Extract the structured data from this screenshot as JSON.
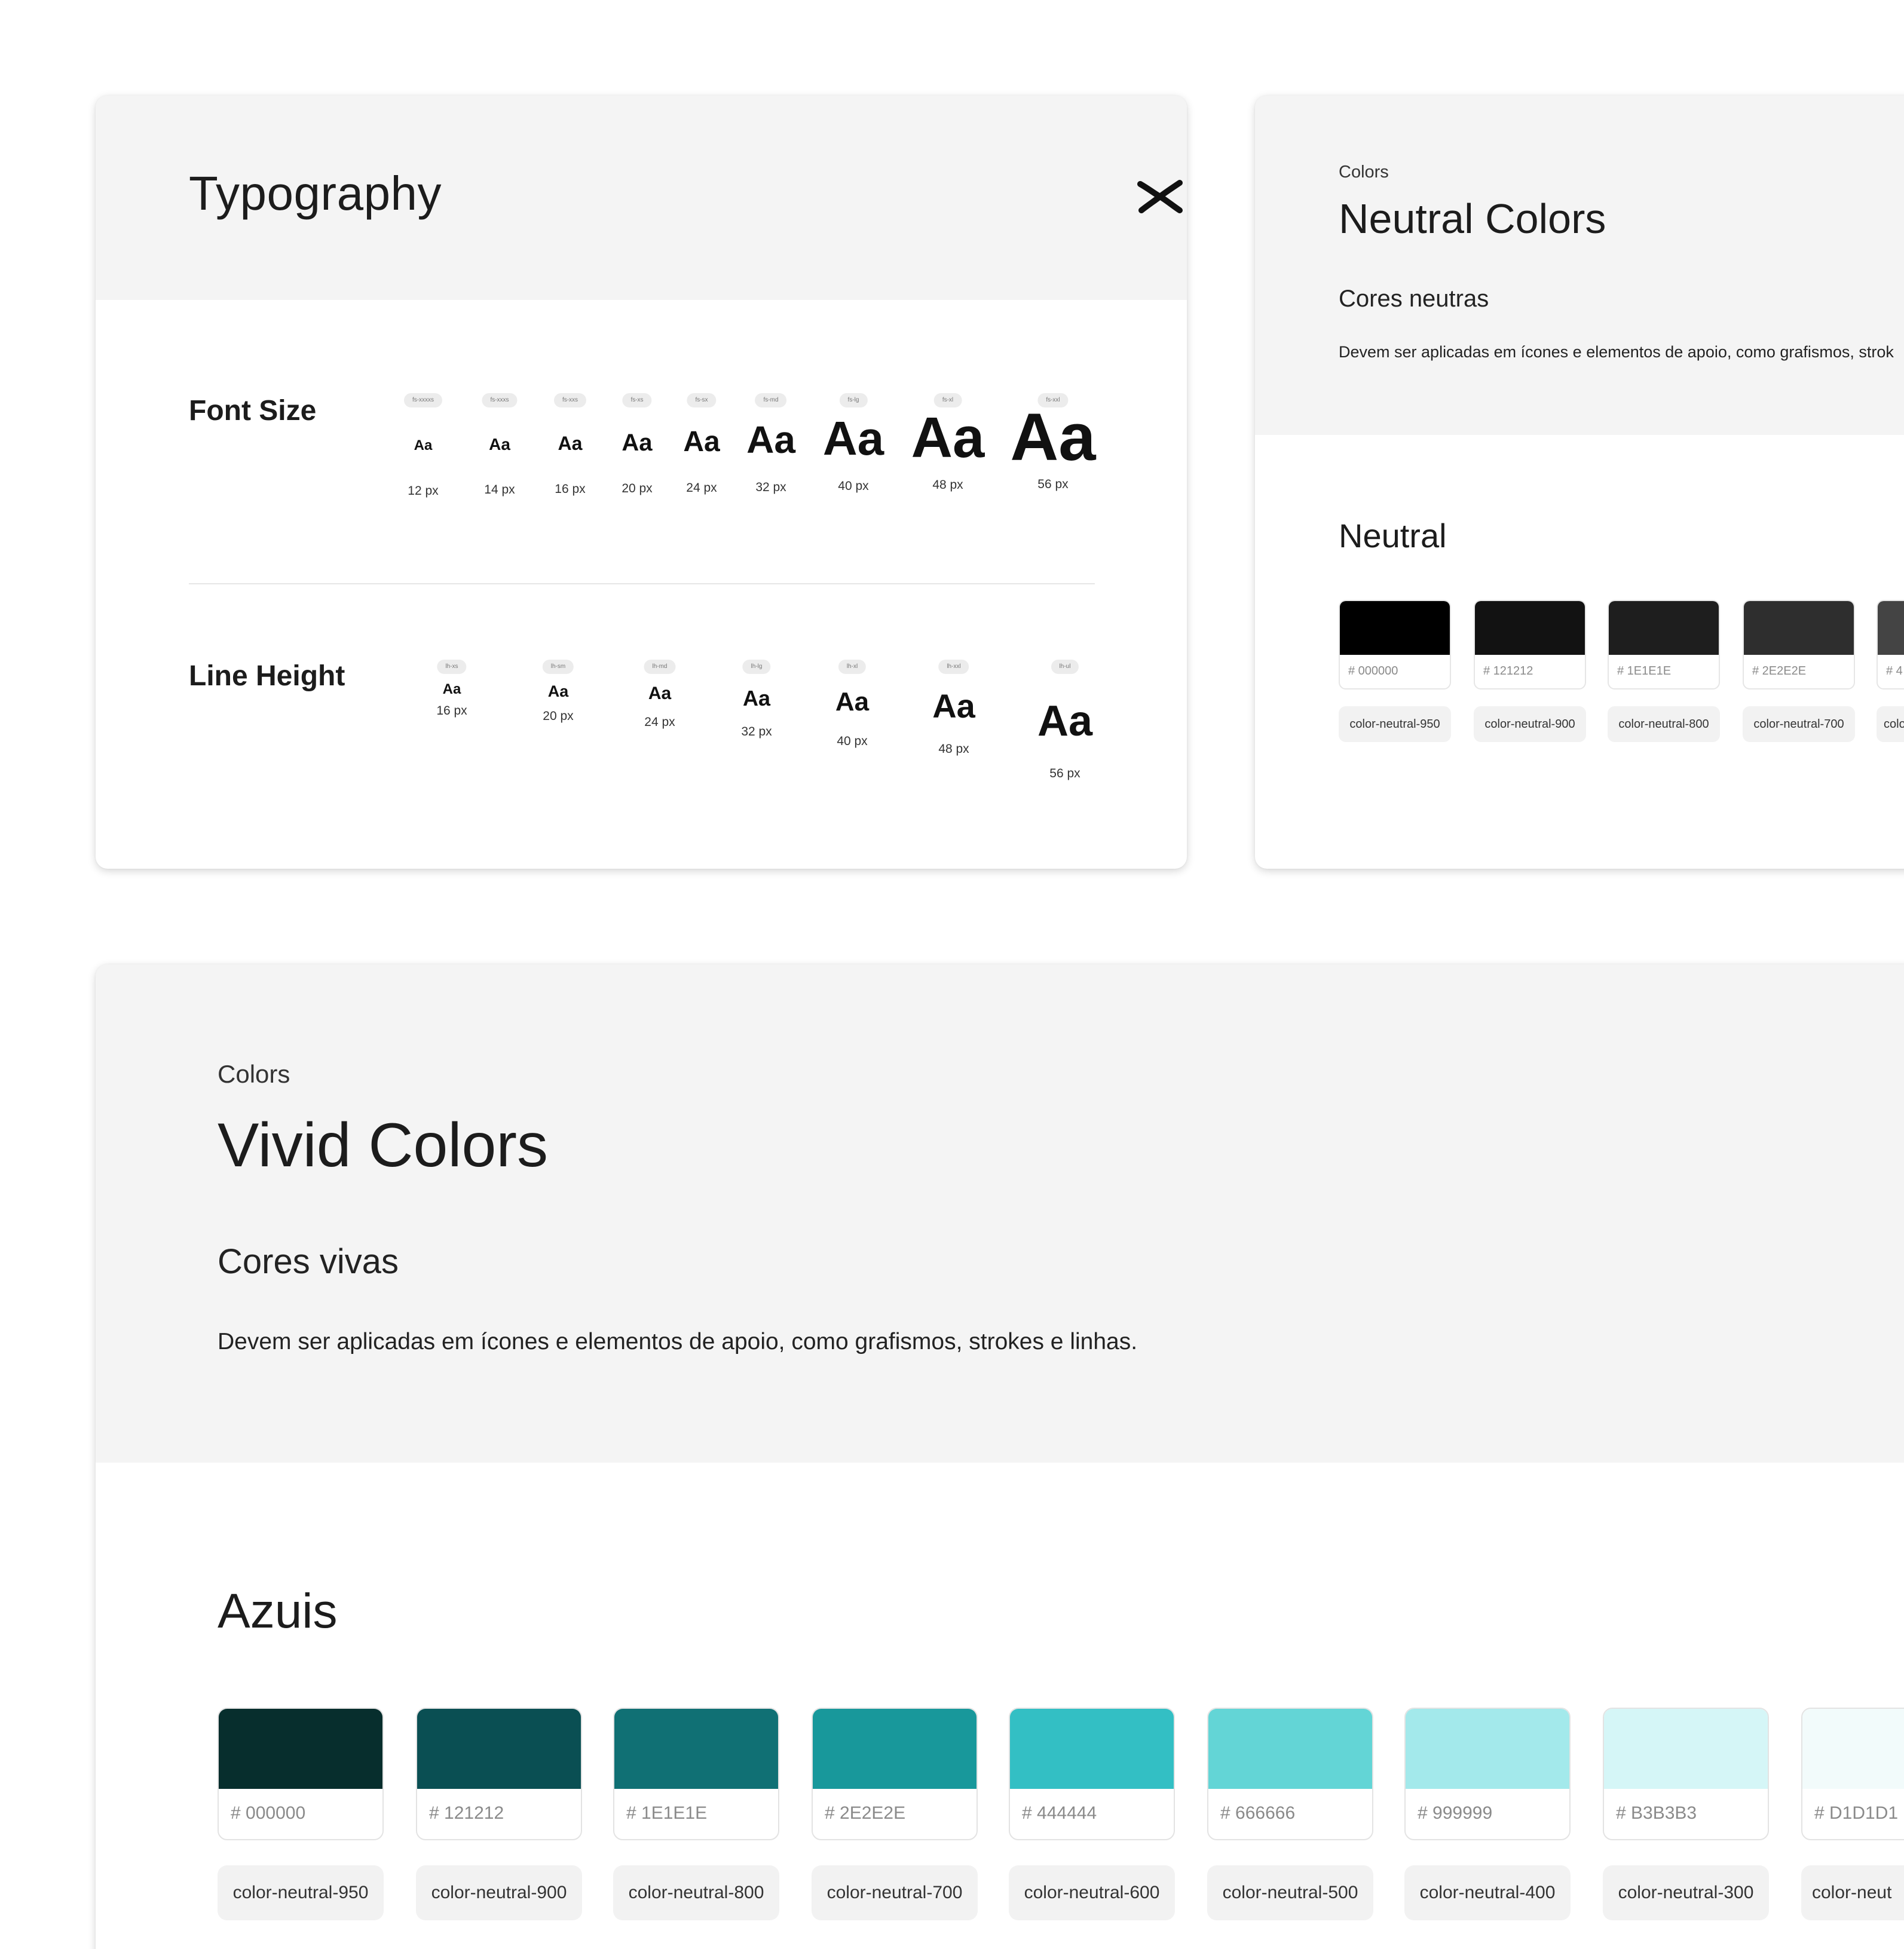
{
  "typography": {
    "title": "Typography",
    "font_size_label": "Font Size",
    "line_height_label": "Line Height",
    "font_sizes": [
      {
        "token": "fs-xxxxs",
        "sample": "Aa",
        "label": "12 px"
      },
      {
        "token": "fs-xxxs",
        "sample": "Aa",
        "label": "14 px"
      },
      {
        "token": "fs-xxs",
        "sample": "Aa",
        "label": "16 px"
      },
      {
        "token": "fs-xs",
        "sample": "Aa",
        "label": "20 px"
      },
      {
        "token": "fs-sx",
        "sample": "Aa",
        "label": "24 px"
      },
      {
        "token": "fs-md",
        "sample": "Aa",
        "label": "32 px"
      },
      {
        "token": "fs-lg",
        "sample": "Aa",
        "label": "40 px"
      },
      {
        "token": "fs-xl",
        "sample": "Aa",
        "label": "48 px"
      },
      {
        "token": "fs-xxl",
        "sample": "Aa",
        "label": "56 px"
      }
    ],
    "line_heights": [
      {
        "token": "lh-xs",
        "sample": "Aa",
        "label": "16 px"
      },
      {
        "token": "lh-sm",
        "sample": "Aa",
        "label": "20 px"
      },
      {
        "token": "lh-md",
        "sample": "Aa",
        "label": "24 px"
      },
      {
        "token": "lh-lg",
        "sample": "Aa",
        "label": "32 px"
      },
      {
        "token": "lh-xl",
        "sample": "Aa",
        "label": "40 px"
      },
      {
        "token": "lh-xxl",
        "sample": "Aa",
        "label": "48 px"
      },
      {
        "token": "lh-ul",
        "sample": "Aa",
        "label": "56 px"
      }
    ]
  },
  "neutral_card": {
    "eyebrow": "Colors",
    "title": "Neutral Colors",
    "subtitle": "Cores neutras",
    "description": "Devem ser aplicadas em ícones e elementos de apoio, como grafismos, strok",
    "group_title": "Neutral",
    "swatches": [
      {
        "color": "#000000",
        "hex": "# 000000",
        "name": "color-neutral-950"
      },
      {
        "color": "#121212",
        "hex": "# 121212",
        "name": "color-neutral-900"
      },
      {
        "color": "#1e1e1e",
        "hex": "# 1E1E1E",
        "name": "color-neutral-800"
      },
      {
        "color": "#2e2e2e",
        "hex": "# 2E2E2E",
        "name": "color-neutral-700"
      },
      {
        "color": "#444444",
        "hex": "# 4",
        "name": "colo"
      }
    ]
  },
  "vivid_card": {
    "eyebrow": "Colors",
    "title": "Vivid Colors",
    "subtitle": "Cores vivas",
    "description": "Devem ser aplicadas em ícones e elementos de apoio, como grafismos, strokes e linhas.",
    "group_title": "Azuis",
    "swatches": [
      {
        "color": "#072e2d",
        "hex": "# 000000",
        "name": "color-neutral-950"
      },
      {
        "color": "#0a4f53",
        "hex": "# 121212",
        "name": "color-neutral-900"
      },
      {
        "color": "#107074",
        "hex": "# 1E1E1E",
        "name": "color-neutral-800"
      },
      {
        "color": "#18989b",
        "hex": "# 2E2E2E",
        "name": "color-neutral-700"
      },
      {
        "color": "#33bfc4",
        "hex": "# 444444",
        "name": "color-neutral-600"
      },
      {
        "color": "#63d5d6",
        "hex": "# 666666",
        "name": "color-neutral-500"
      },
      {
        "color": "#a3e9eb",
        "hex": "# 999999",
        "name": "color-neutral-400"
      },
      {
        "color": "#d5f6f7",
        "hex": "# B3B3B3",
        "name": "color-neutral-300"
      },
      {
        "color": "#f2fbfb",
        "hex": "# D1D1D1",
        "name": "color-neut"
      }
    ]
  }
}
